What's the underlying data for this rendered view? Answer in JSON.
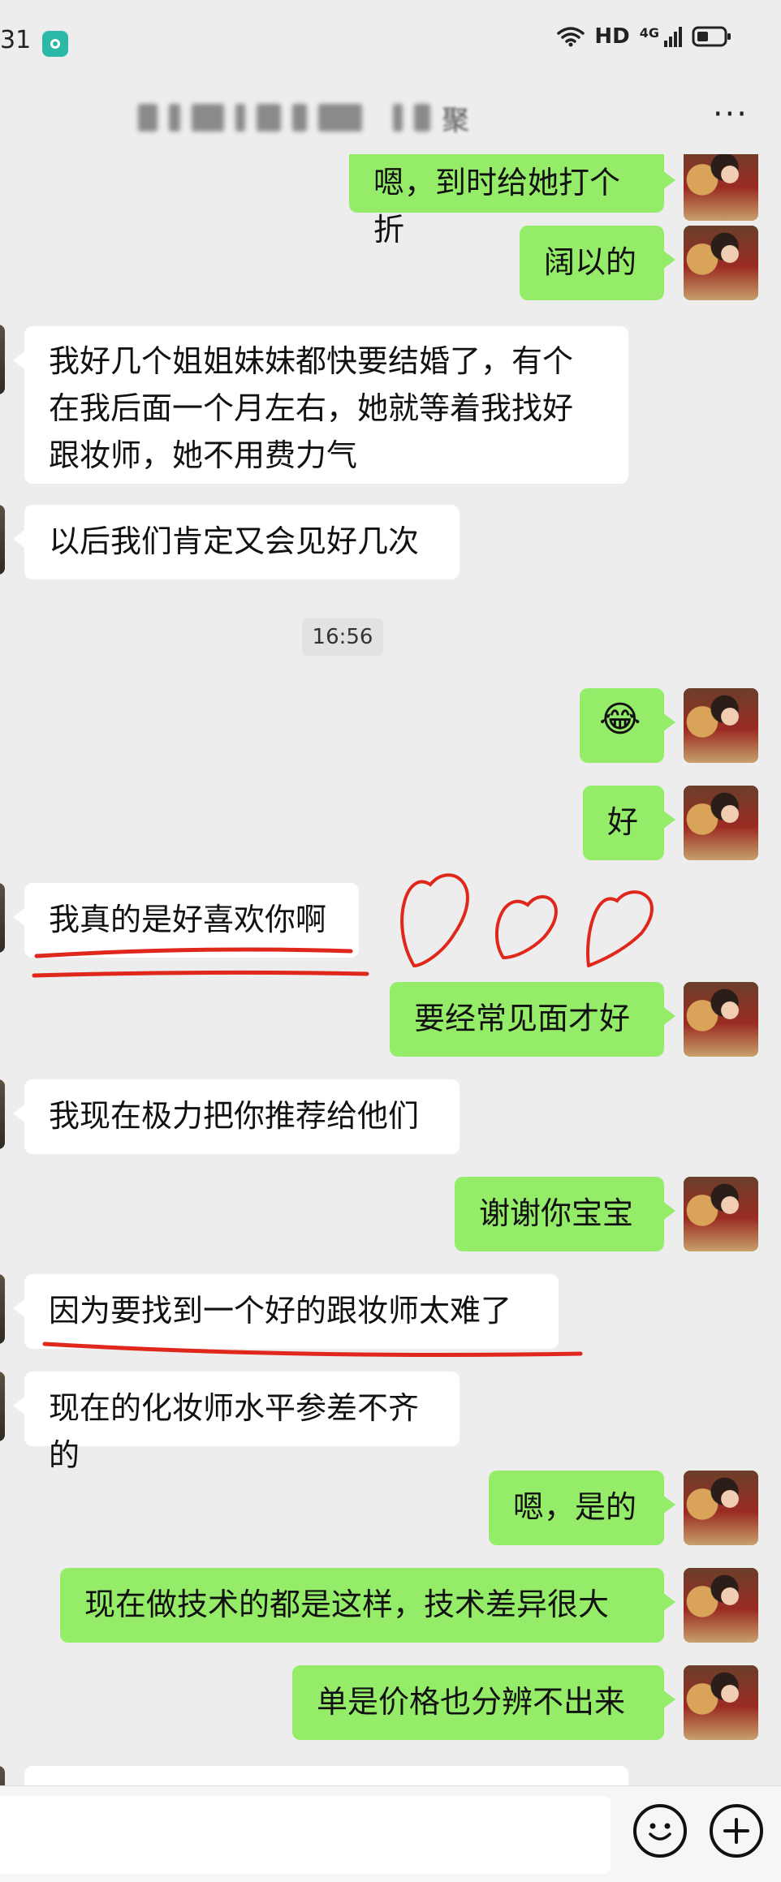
{
  "status_bar": {
    "time": "31",
    "network": "HD",
    "cellular": "4G"
  },
  "header": {
    "contact_visible_suffix": "聚",
    "more": "···"
  },
  "chat": {
    "timestamp": "16:56",
    "messages": [
      {
        "side": "out",
        "text": "嗯，到时给她打个折"
      },
      {
        "side": "out",
        "text": "阔以的"
      },
      {
        "side": "in",
        "text": "我好几个姐姐妹妹都快要结婚了，有个\n在我后面一个月左右，她就等着我找好\n跟妆师，她不用费力气"
      },
      {
        "side": "in",
        "text": "以后我们肯定又会见好几次"
      },
      {
        "side": "out",
        "text": "😂"
      },
      {
        "side": "out",
        "text": "好"
      },
      {
        "side": "in",
        "text": "我真的是好喜欢你啊"
      },
      {
        "side": "out",
        "text": "要经常见面才好"
      },
      {
        "side": "in",
        "text": "我现在极力把你推荐给他们"
      },
      {
        "side": "out",
        "text": "谢谢你宝宝"
      },
      {
        "side": "in",
        "text": "因为要找到一个好的跟妆师太难了"
      },
      {
        "side": "in",
        "text": "现在的化妆师水平参差不齐的"
      },
      {
        "side": "out",
        "text": "嗯，是的"
      },
      {
        "side": "out",
        "text": "现在做技术的都是这样，技术差异很大"
      },
      {
        "side": "out",
        "text": "单是价格也分辨不出来"
      },
      {
        "side": "in",
        "text": ""
      }
    ]
  },
  "input_bar": {
    "emoji_icon": "smile-icon",
    "plus_icon": "plus-icon"
  },
  "colors": {
    "outgoing": "#95ec69",
    "incoming": "#ffffff",
    "background": "#ededed",
    "annotation": "#e0271b"
  }
}
